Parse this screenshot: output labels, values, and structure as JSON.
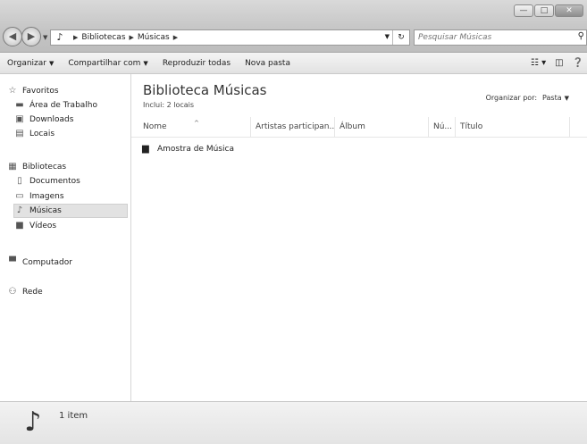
{
  "window": {
    "address": [
      "Bibliotecas",
      "Músicas"
    ],
    "search_placeholder": "Pesquisar Músicas",
    "buttons": {
      "minimize": "—",
      "maximize": "□",
      "close": "✕"
    }
  },
  "toolbar": {
    "organize": "Organizar",
    "share": "Compartilhar com",
    "play_all": "Reproduzir todas",
    "new_folder": "Nova pasta"
  },
  "nav": {
    "favorites": "Favoritos",
    "desktop": "Área de Trabalho",
    "downloads": "Downloads",
    "places": "Locais",
    "libraries": "Bibliotecas",
    "documents": "Documentos",
    "images": "Imagens",
    "music": "Músicas",
    "videos": "Vídeos",
    "computer": "Computador",
    "network": "Rede"
  },
  "library": {
    "title": "Biblioteca Músicas",
    "subtitle": "Inclui: 2 locais",
    "arrange_label": "Organizar por:",
    "arrange_value": "Pasta"
  },
  "columns": {
    "name": "Nome",
    "artists": "Artistas participan...",
    "album": "Álbum",
    "number": "Nú...",
    "title": "Título"
  },
  "files": [
    {
      "name": "Amostra de Música"
    }
  ],
  "details": {
    "count": "1 item"
  }
}
